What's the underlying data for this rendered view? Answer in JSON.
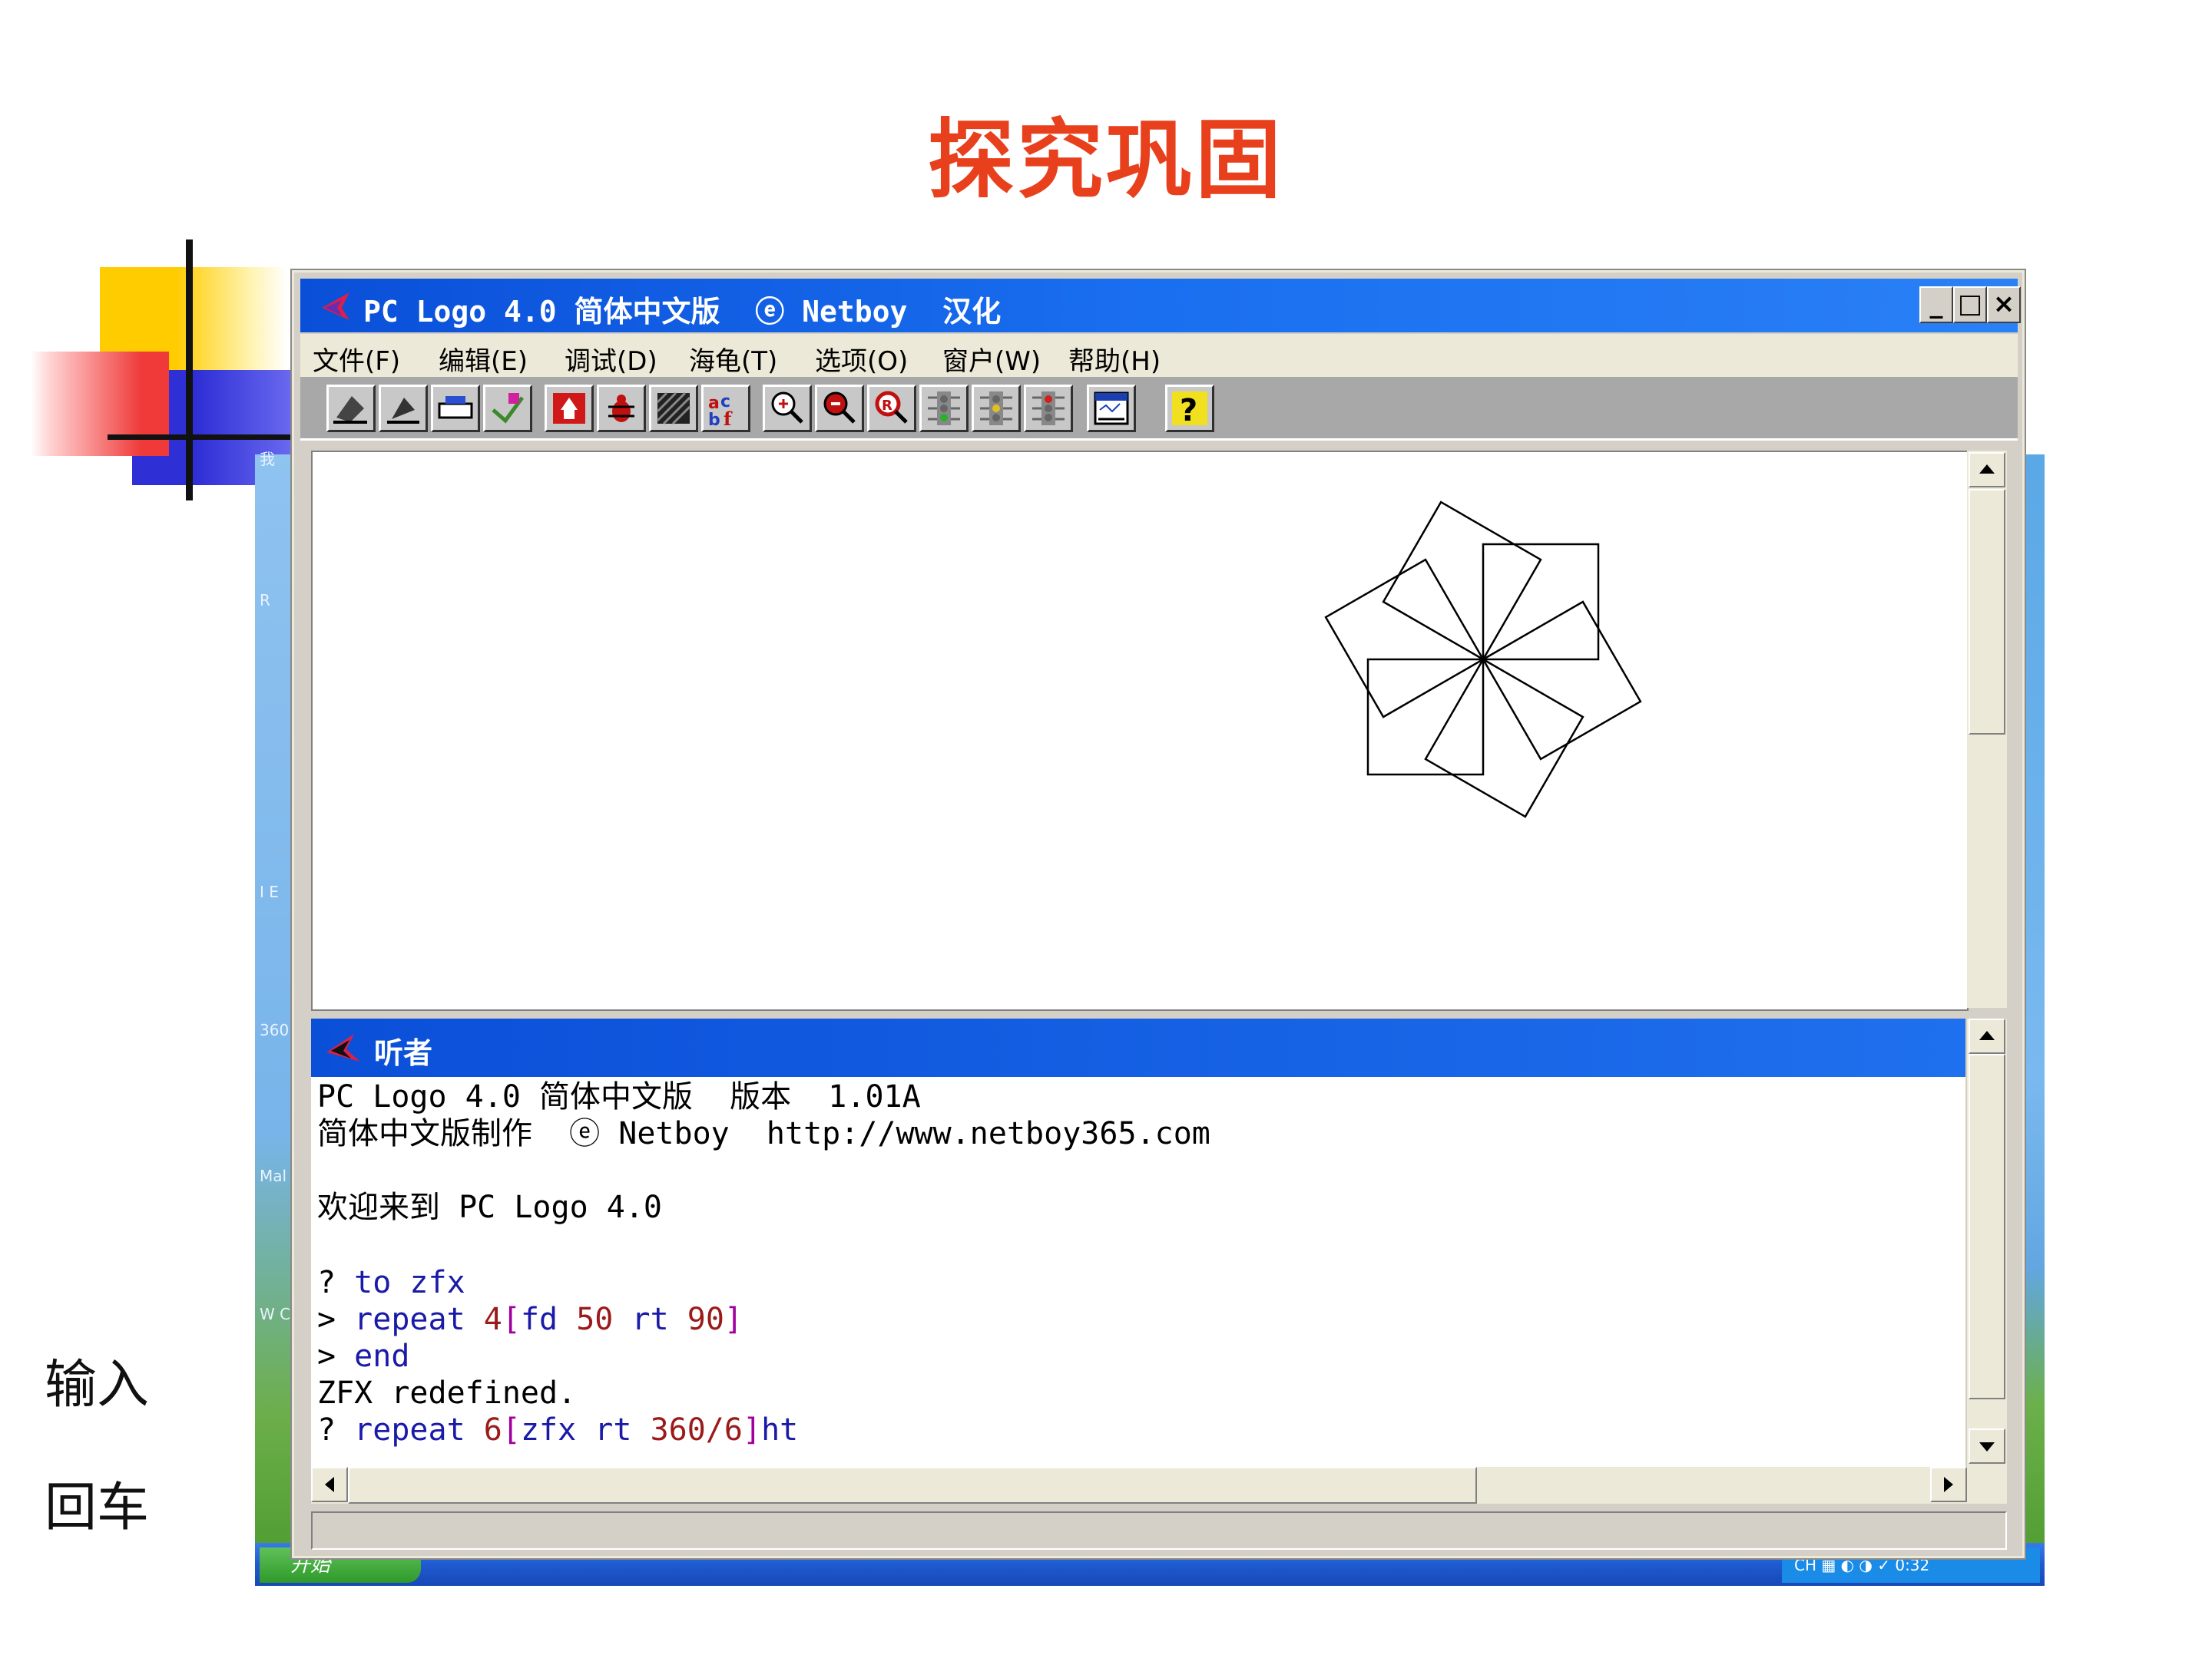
{
  "slide": {
    "title": "探究巩固"
  },
  "window": {
    "title": "PC Logo 4.0 简体中文版  ⓔ Netboy  汉化",
    "minimize": "_",
    "maximize": "□",
    "close": "×"
  },
  "menu": {
    "items": [
      "文件(F)",
      "编辑(E)",
      "调试(D)",
      "海龟(T)",
      "选项(O)",
      "窗户(W)",
      "帮助(H)"
    ]
  },
  "toolbar": {
    "buttons": [
      "open-file-icon",
      "save-file-icon",
      "print-icon",
      "edit-icon",
      "turtle-home-icon",
      "bug-icon",
      "pattern-icon",
      "font-icon",
      "zoom-in-icon",
      "zoom-out-icon",
      "zoom-reset-icon",
      "traffic-go-icon",
      "traffic-pause-icon",
      "traffic-stop-icon",
      "window-icon",
      "help-icon"
    ]
  },
  "listener": {
    "title": "听者",
    "lines": {
      "l1": "PC Logo 4.0 简体中文版  版本  1.01A",
      "l2": "简体中文版制作  ⓔ Netboy  http://www.netboy365.com",
      "l3": "欢迎来到 PC Logo 4.0",
      "l4_prompt": "? ",
      "l4_cmd": "to zfx",
      "l5_prompt": "> ",
      "l5_cmd": "repeat",
      "l5_num": "4",
      "l5_open": "[",
      "l5_body": "fd",
      "l5_n1": "50",
      "l5_rt": "rt",
      "l5_n2": "90",
      "l5_close": "]",
      "l6_prompt": "> ",
      "l6_cmd": "end",
      "l7": "ZFX redefined.",
      "l8_prompt": "? ",
      "l8_cmd": "repeat",
      "l8_num": "6",
      "l8_open": "[",
      "l8_body": "zfx",
      "l8_rt": "rt",
      "l8_n": "360/6",
      "l8_close": "]",
      "l8_tail": "ht"
    }
  },
  "drawing": {
    "squares": 6,
    "side": 50,
    "turn_deg": 60
  },
  "desktop": {
    "labels": [
      "我",
      "R",
      "I E",
      "360",
      "Mal",
      "W C"
    ],
    "start": "开始",
    "tray": "CH ▦  ◐ ◑ ✓  0:32"
  },
  "side_notes": {
    "input": "输入",
    "enter": "回车"
  },
  "colors": {
    "title_red": "#e8401c",
    "titlebar_blue": "#0a4fd8",
    "keyword_blue": "#1a1aa8",
    "number_red": "#9b1a1a",
    "bracket_purple": "#a000a0"
  }
}
